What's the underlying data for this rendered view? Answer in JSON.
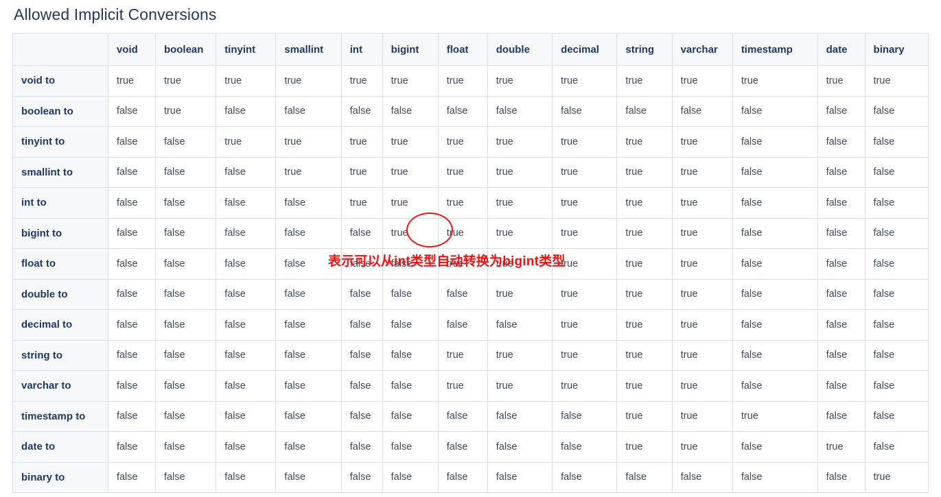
{
  "page": {
    "title": "Allowed Implicit Conversions"
  },
  "table": {
    "corner_label": "",
    "columns": [
      "void",
      "boolean",
      "tinyint",
      "smallint",
      "int",
      "bigint",
      "float",
      "double",
      "decimal",
      "string",
      "varchar",
      "timestamp",
      "date",
      "binary"
    ],
    "rows": [
      {
        "label": "void to",
        "values": [
          "true",
          "true",
          "true",
          "true",
          "true",
          "true",
          "true",
          "true",
          "true",
          "true",
          "true",
          "true",
          "true",
          "true"
        ]
      },
      {
        "label": "boolean to",
        "values": [
          "false",
          "true",
          "false",
          "false",
          "false",
          "false",
          "false",
          "false",
          "false",
          "false",
          "false",
          "false",
          "false",
          "false"
        ]
      },
      {
        "label": "tinyint to",
        "values": [
          "false",
          "false",
          "true",
          "true",
          "true",
          "true",
          "true",
          "true",
          "true",
          "true",
          "true",
          "false",
          "false",
          "false"
        ]
      },
      {
        "label": "smallint to",
        "values": [
          "false",
          "false",
          "false",
          "true",
          "true",
          "true",
          "true",
          "true",
          "true",
          "true",
          "true",
          "false",
          "false",
          "false"
        ]
      },
      {
        "label": "int to",
        "values": [
          "false",
          "false",
          "false",
          "false",
          "true",
          "true",
          "true",
          "true",
          "true",
          "true",
          "true",
          "false",
          "false",
          "false"
        ]
      },
      {
        "label": "bigint to",
        "values": [
          "false",
          "false",
          "false",
          "false",
          "false",
          "true",
          "true",
          "true",
          "true",
          "true",
          "true",
          "false",
          "false",
          "false"
        ]
      },
      {
        "label": "float to",
        "values": [
          "false",
          "false",
          "false",
          "false",
          "false",
          "false",
          "true",
          "true",
          "true",
          "true",
          "true",
          "false",
          "false",
          "false"
        ]
      },
      {
        "label": "double to",
        "values": [
          "false",
          "false",
          "false",
          "false",
          "false",
          "false",
          "false",
          "true",
          "true",
          "true",
          "true",
          "false",
          "false",
          "false"
        ]
      },
      {
        "label": "decimal to",
        "values": [
          "false",
          "false",
          "false",
          "false",
          "false",
          "false",
          "false",
          "false",
          "true",
          "true",
          "true",
          "false",
          "false",
          "false"
        ]
      },
      {
        "label": "string to",
        "values": [
          "false",
          "false",
          "false",
          "false",
          "false",
          "false",
          "true",
          "true",
          "true",
          "true",
          "true",
          "false",
          "false",
          "false"
        ]
      },
      {
        "label": "varchar to",
        "values": [
          "false",
          "false",
          "false",
          "false",
          "false",
          "false",
          "true",
          "true",
          "true",
          "true",
          "true",
          "false",
          "false",
          "false"
        ]
      },
      {
        "label": "timestamp to",
        "values": [
          "false",
          "false",
          "false",
          "false",
          "false",
          "false",
          "false",
          "false",
          "false",
          "true",
          "true",
          "true",
          "false",
          "false"
        ]
      },
      {
        "label": "date to",
        "values": [
          "false",
          "false",
          "false",
          "false",
          "false",
          "false",
          "false",
          "false",
          "false",
          "true",
          "true",
          "false",
          "true",
          "false"
        ]
      },
      {
        "label": "binary to",
        "values": [
          "false",
          "false",
          "false",
          "false",
          "false",
          "false",
          "false",
          "false",
          "false",
          "false",
          "false",
          "false",
          "false",
          "true"
        ]
      }
    ]
  },
  "annotation": {
    "text": "表示可以从int类型自动转换为bigint类型",
    "color": "#ee1111",
    "highlight_row": "int to",
    "highlight_column": "bigint",
    "highlight_value": "true"
  }
}
